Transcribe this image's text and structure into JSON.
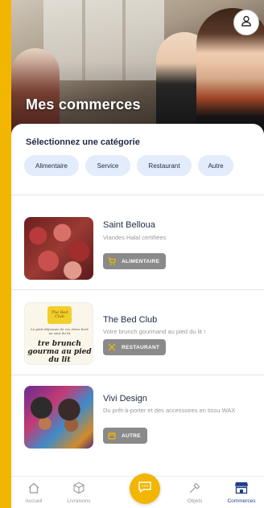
{
  "header": {
    "title": "Mes commerces"
  },
  "categories": {
    "title": "Sélectionnez une catégorie",
    "chips": [
      {
        "label": "Alimentaire"
      },
      {
        "label": "Service"
      },
      {
        "label": "Restaurant"
      },
      {
        "label": "Autre"
      }
    ]
  },
  "shops": [
    {
      "name": "Saint Belloua",
      "description": "Viandes Halal certifiées",
      "badge": "ALIMENTAIRE",
      "badge_icon": "cart-icon"
    },
    {
      "name": "The Bed Club",
      "description": "Votre brunch gourmand au pied du lit !",
      "badge": "RESTAURANT",
      "badge_icon": "utensils-icon",
      "thumb_logo": "The Bed Club",
      "thumb_tagline": "Le petit-déjeuner de vos rêves livré au saut du lit",
      "thumb_text": "tre brunch gourma au pied du lit"
    },
    {
      "name": "Vivi Design",
      "description": "Du prêt-à-porter et des accessoires en tissu WAX",
      "badge": "AUTRE",
      "badge_icon": "calendar-icon"
    }
  ],
  "tabbar": {
    "items": [
      {
        "label": "Accueil",
        "icon": "home-icon"
      },
      {
        "label": "Livraisons",
        "icon": "box-icon"
      },
      {
        "label": "",
        "icon": "chat-icon"
      },
      {
        "label": "Objets",
        "icon": "tools-icon"
      },
      {
        "label": "Commerces",
        "icon": "shop-icon"
      }
    ],
    "active": "Commerces"
  },
  "colors": {
    "accent": "#f2b600",
    "chip_bg": "#e3ecfb",
    "text_dark": "#1f2a44",
    "badge_bg": "#8a8a8a",
    "active_tab": "#1f3f8a"
  }
}
